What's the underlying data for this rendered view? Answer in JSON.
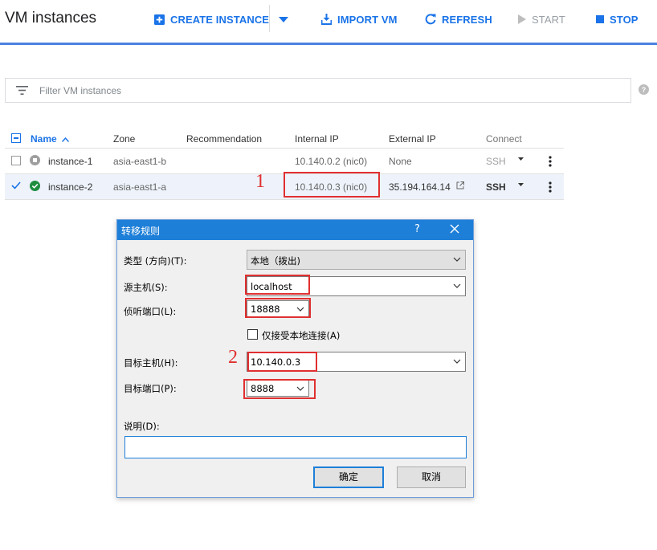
{
  "header": {
    "title": "VM instances",
    "toolbar": {
      "create": "CREATE INSTANCE",
      "import": "IMPORT VM",
      "refresh": "REFRESH",
      "start": "START",
      "stop": "STOP"
    }
  },
  "filter": {
    "placeholder": "Filter VM instances"
  },
  "table": {
    "columns": {
      "name": "Name",
      "zone": "Zone",
      "recommendation": "Recommendation",
      "internal_ip": "Internal IP",
      "external_ip": "External IP",
      "connect": "Connect"
    },
    "rows": [
      {
        "name": "instance-1",
        "zone": "asia-east1-b",
        "recommendation": "",
        "internal_ip": "10.140.0.2 (nic0)",
        "external_ip": "None",
        "connect": "SSH",
        "status": "stopped"
      },
      {
        "name": "instance-2",
        "zone": "asia-east1-a",
        "recommendation": "",
        "internal_ip": "10.140.0.3 (nic0)",
        "external_ip": "35.194.164.14",
        "connect": "SSH",
        "status": "running"
      }
    ]
  },
  "annotations": {
    "one": "1",
    "two": "2"
  },
  "dialog": {
    "title": "转移规则",
    "help": "?",
    "type_label": "类型 (方向)(T):",
    "type_value": "本地（拨出)",
    "source_host_label": "源主机(S):",
    "source_host_value": "localhost",
    "listen_port_label": "侦听端口(L):",
    "listen_port_value": "18888",
    "local_only_label": "仅接受本地连接(A)",
    "target_host_label": "目标主机(H):",
    "target_host_value": "10.140.0.3",
    "target_port_label": "目标端口(P):",
    "target_port_value": "8888",
    "description_label": "说明(D):",
    "description_value": "",
    "ok": "确定",
    "cancel": "取消"
  },
  "colors": {
    "accent": "#1a73e8",
    "header_rule": "#4a80e0",
    "annotation": "#e03030",
    "running": "#1e8e3e",
    "dialog_title": "#1e7fd8"
  }
}
